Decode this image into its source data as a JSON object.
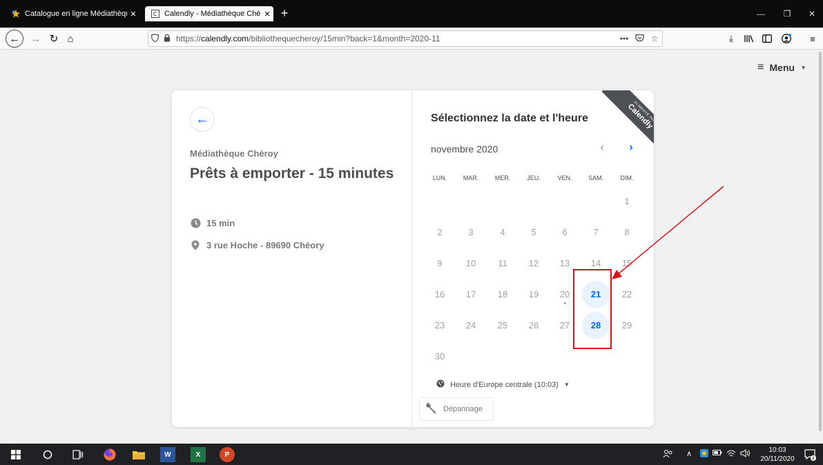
{
  "browser": {
    "tabs": [
      {
        "label": "Catalogue en ligne Médiathèqu",
        "close": "✕",
        "favicon": "star-favicon"
      },
      {
        "label": "Calendly - Médiathèque Chéroy",
        "close": "✕",
        "favicon": "calendly-favicon"
      }
    ],
    "new_tab": "+",
    "url_host": "calendly.com",
    "url_prefix": "https://",
    "url_path": "/bibliothequecheroy/15min?back=1&month=2020-11",
    "page_actions": "•••"
  },
  "page": {
    "menu_label": "Menu",
    "back_arrow": "←",
    "organizer": "Médiathèque Chéroy",
    "event_title": "Prêts à emporter - 15 minutes",
    "duration": "15 min",
    "location": "3 rue Hoche - 89690 Chéory",
    "ribbon_small": "ALIMENTÉ PAR",
    "ribbon_brand": "Calendly",
    "select_title": "Sélectionnez la date et l'heure",
    "month_label": "novembre 2020",
    "prev_month": "‹",
    "next_month": "›",
    "weekdays": [
      "LUN.",
      "MAR.",
      "MER.",
      "JEU.",
      "VEN.",
      "SAM.",
      "DIM."
    ],
    "days": [
      "1",
      "2",
      "3",
      "4",
      "5",
      "6",
      "7",
      "8",
      "9",
      "10",
      "11",
      "12",
      "13",
      "14",
      "15",
      "16",
      "17",
      "18",
      "19",
      "20",
      "21",
      "22",
      "23",
      "24",
      "25",
      "26",
      "27",
      "28",
      "29",
      "30"
    ],
    "available_days": [
      21,
      28
    ],
    "today": 20,
    "timezone": "Heure d'Europe centrale (10:03)",
    "troubleshoot": "Dépannage"
  },
  "taskbar": {
    "word": "W",
    "excel": "X",
    "ppt": "P",
    "time": "10:03",
    "date": "20/11/2020"
  },
  "colors": {
    "accent": "#0069ff",
    "available_bg": "#e9f3fe",
    "annotation": "#e0101a"
  }
}
